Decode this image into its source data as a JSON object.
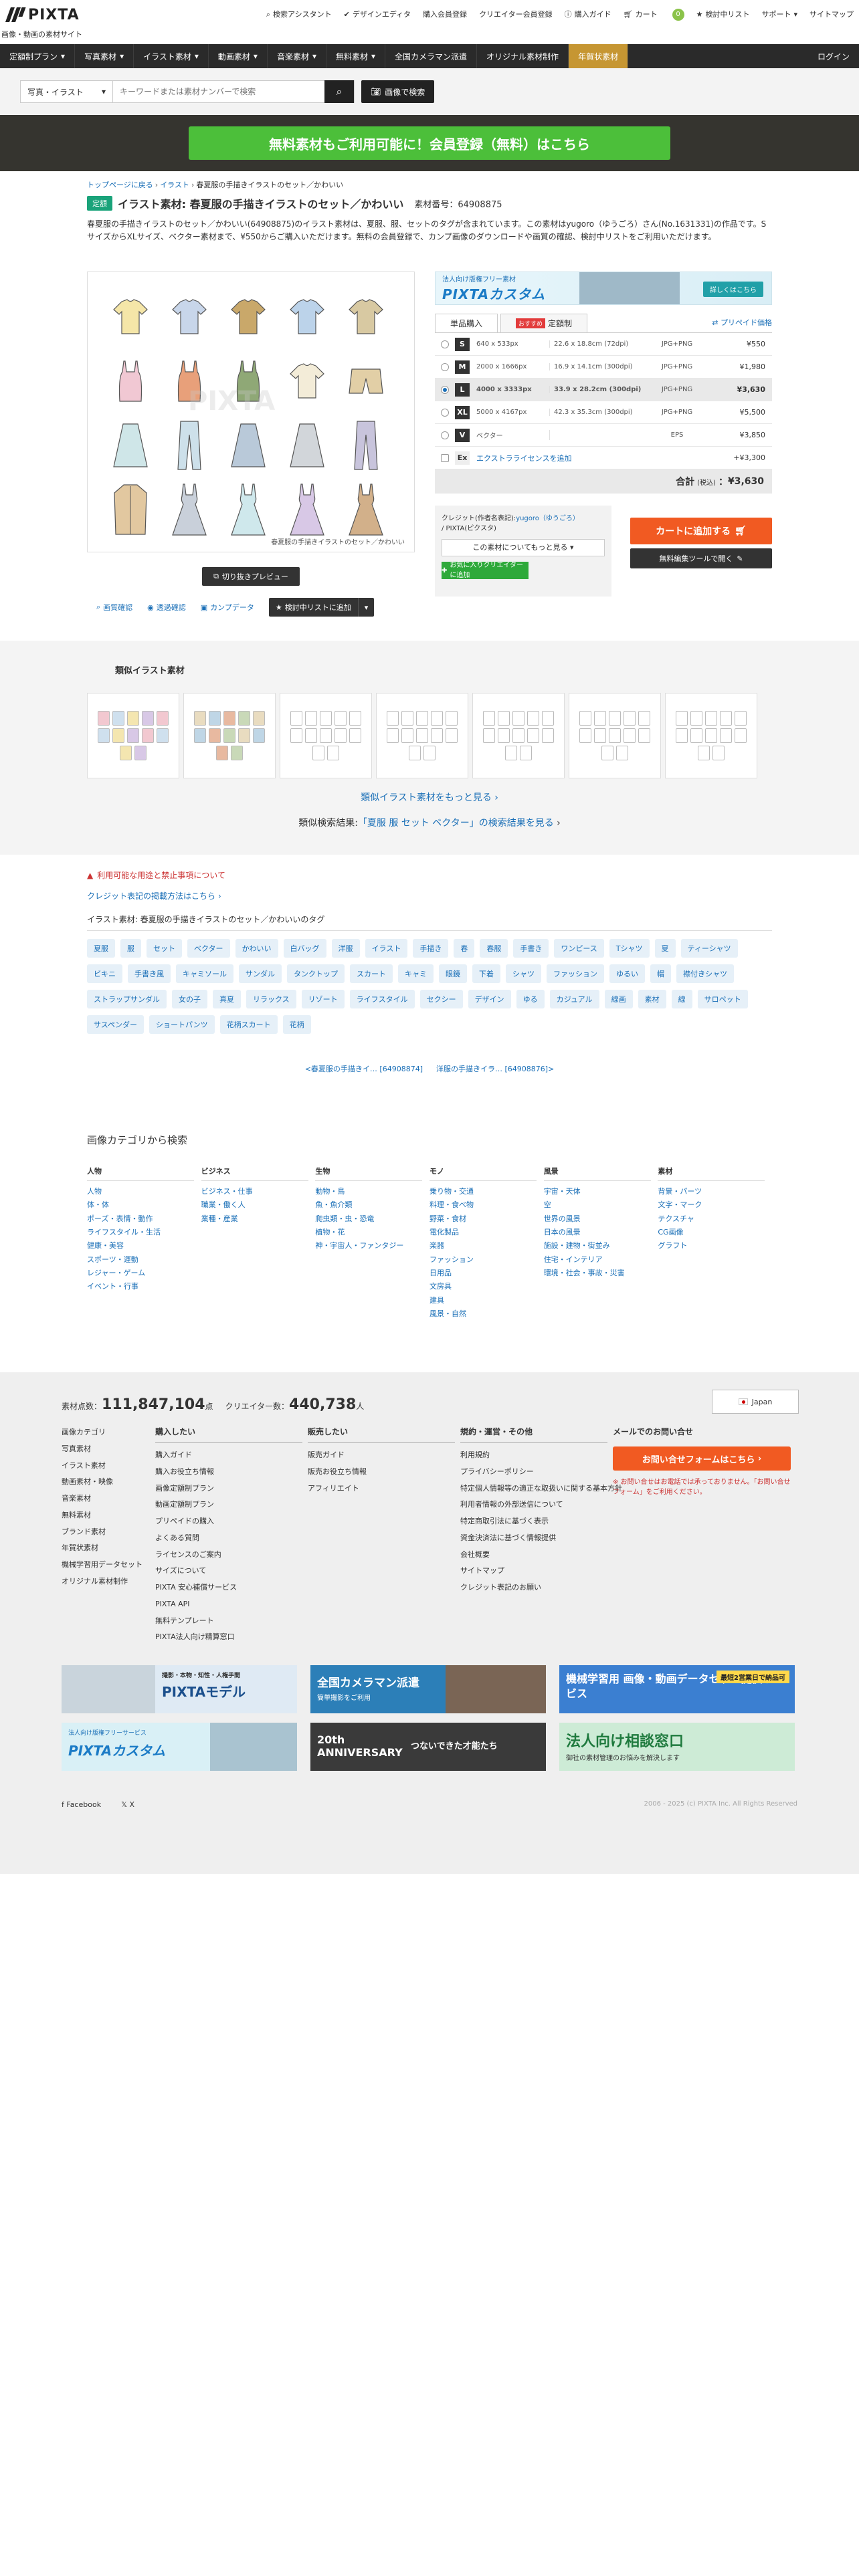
{
  "header": {
    "logo": "PIXTA",
    "subtitle": "画像・動画の素材サイト",
    "nav": [
      {
        "icon": "search-icon",
        "label": "検索アシスタント"
      },
      {
        "icon": "check-icon",
        "label": "デザインエディタ"
      },
      {
        "icon": "",
        "label": "購入会員登録"
      },
      {
        "icon": "",
        "label": "クリエイター会員登録"
      },
      {
        "icon": "info-icon",
        "label": "購入ガイド"
      },
      {
        "icon": "cart-icon",
        "label": "カート",
        "badge": "0"
      },
      {
        "icon": "star-icon",
        "label": "検討中リスト"
      },
      {
        "icon": "",
        "label": "サポート"
      },
      {
        "icon": "",
        "label": "サイトマップ"
      }
    ]
  },
  "gnav": {
    "items": [
      "定額制プラン",
      "写真素材",
      "イラスト素材",
      "動画素材",
      "音楽素材",
      "無料素材",
      "全国カメラマン派遣",
      "オリジナル素材制作"
    ],
    "sale": "年賀状素材",
    "login": "ログイン"
  },
  "search": {
    "category": "写真・イラスト",
    "placeholder": "キーワードまたは素材ナンバーで検索",
    "image_search": "画像で検索"
  },
  "banner": {
    "label": "無料素材もご利用可能に！会員登録（無料）はこちら"
  },
  "breadcrumb": [
    "トップページに戻る",
    "イラスト",
    "春夏服の手描きイラストのセット／かわいい"
  ],
  "item": {
    "badge": "定額",
    "title": "イラスト素材: 春夏服の手描きイラストのセット／かわいい",
    "number_label": "素材番号：64908875",
    "description": "春夏服の手描きイラストのセット／かわいい(64908875)のイラスト素材は、夏服、服、セットのタグが含まれています。この素材はyugoro（ゆうごろ）さん(No.1631331)の作品です。SサイズからXLサイズ、ベクター素材まで、¥550からご購入いただけます。無料の会員登録で、カンプ画像のダウンロードや画質の確認、検討中リストをご利用いただけます。",
    "caption": "春夏服の手描きイラストのセット／かわいい",
    "watermark": "PIXTA",
    "preview": "切り抜きプレビュー",
    "links": [
      {
        "icon": "zoom-icon",
        "label": "画質確認"
      },
      {
        "icon": "eye-icon",
        "label": "透過確認"
      },
      {
        "icon": "image-icon",
        "label": "カンプデータ"
      }
    ],
    "fav": "検討中リストに追加"
  },
  "custom_banner": {
    "sub": "法人向け版権フリー素材",
    "title": "PIXTAカスタム",
    "btn": "詳しくはこちら"
  },
  "tabs": {
    "single": "単品購入",
    "osusume": "おすすめ",
    "subscription": "定額制",
    "prepaid": "プリペイド価格"
  },
  "sizes": [
    {
      "size": "S",
      "px": "640 x 533px",
      "cm": "22.6 x 18.8cm (72dpi)",
      "fmt": "JPG+PNG",
      "price": "¥550",
      "selected": false
    },
    {
      "size": "M",
      "px": "2000 x 1666px",
      "cm": "16.9 x 14.1cm (300dpi)",
      "fmt": "JPG+PNG",
      "price": "¥1,980",
      "selected": false
    },
    {
      "size": "L",
      "px": "4000 x 3333px",
      "cm": "33.9 x 28.2cm (300dpi)",
      "fmt": "JPG+PNG",
      "price": "¥3,630",
      "selected": true
    },
    {
      "size": "XL",
      "px": "5000 x 4167px",
      "cm": "42.3 x 35.3cm (300dpi)",
      "fmt": "JPG+PNG",
      "price": "¥5,500",
      "selected": false
    },
    {
      "size": "V",
      "px": "ベクター",
      "cm": "",
      "fmt": "EPS",
      "price": "¥3,850",
      "selected": false
    }
  ],
  "extra": {
    "size": "Ex",
    "label": "エクストラライセンスを追加",
    "price": "+¥3,300"
  },
  "total": {
    "label": "合計",
    "tax": "(税込)",
    "value": "¥3,630"
  },
  "credit": {
    "label": "クレジット(作者名表記):",
    "author": "yugoro（ゆうごろ）",
    "suffix": "/ PIXTA(ピクスタ)",
    "more": "この素材についてもっと見る",
    "fav": "お気に入りクリエイターに追加"
  },
  "cart": {
    "add": "カートに追加する",
    "edit": "無料編集ツールで開く"
  },
  "similar": {
    "title": "類似イラスト素材",
    "more": "類似イラスト素材をもっと見る",
    "search_prefix": "類似検索結果:",
    "search_link": "「夏服 服 セット ベクター」の検索結果を見る"
  },
  "info": {
    "warn": "利用可能な用途と禁止事項について",
    "credit_link": "クレジット表記の掲載方法はこちら",
    "tag_head": "イラスト素材: 春夏服の手描きイラストのセット／かわいいのタグ",
    "tags": [
      "夏服",
      "服",
      "セット",
      "ベクター",
      "かわいい",
      "白バッグ",
      "洋服",
      "イラスト",
      "手描き",
      "春",
      "春服",
      "手書き",
      "ワンピース",
      "Tシャツ",
      "夏",
      "ティーシャツ",
      "ビキニ",
      "手書き風",
      "キャミソール",
      "サンダル",
      "タンクトップ",
      "スカート",
      "キャミ",
      "眼鏡",
      "下着",
      "シャツ",
      "ファッション",
      "ゆるい",
      "帽",
      "襟付きシャツ",
      "ストラップサンダル",
      "女の子",
      "真夏",
      "リラックス",
      "リゾート",
      "ライフスタイル",
      "セクシー",
      "デザイン",
      "ゆる",
      "カジュアル",
      "線画",
      "素材",
      "線",
      "サロペット",
      "サスペンダー",
      "ショートパンツ",
      "花柄スカート",
      "花柄"
    ],
    "prev": "<春夏服の手描きイ… [64908874]",
    "next": "洋服の手描きイラ… [64908876]>"
  },
  "categories": {
    "title": "画像カテゴリから検索",
    "cols": [
      {
        "h": "人物",
        "items": [
          "人物",
          "体・体",
          "ポーズ・表情・動作",
          "ライフスタイル・生活",
          "健康・美容",
          "スポーツ・運動",
          "レジャー・ゲーム",
          "イベント・行事"
        ]
      },
      {
        "h": "ビジネス",
        "items": [
          "ビジネス・仕事",
          "職業・働く人",
          "業種・産業"
        ]
      },
      {
        "h": "生物",
        "items": [
          "動物・鳥",
          "魚・魚介類",
          "爬虫類・虫・恐竜",
          "植物・花",
          "神・宇宙人・ファンタジー"
        ]
      },
      {
        "h": "モノ",
        "items": [
          "乗り物・交通",
          "料理・食べ物",
          "野菜・食材",
          "電化製品",
          "楽器",
          "ファッション",
          "日用品",
          "文房具",
          "建具",
          "風景・自然"
        ]
      },
      {
        "h": "風景",
        "items": [
          "宇宙・天体",
          "空",
          "世界の風景",
          "日本の風景",
          "施設・建物・街並み",
          "住宅・インテリア",
          "環境・社会・事故・災害"
        ]
      },
      {
        "h": "素材",
        "items": [
          "背景・パーツ",
          "文字・マーク",
          "テクスチャ",
          "CG画像",
          "グラフト"
        ]
      }
    ]
  },
  "footer": {
    "stats_label": "素材点数：",
    "stats_value": "111,847,104",
    "stats_unit": "点",
    "creators_label": "クリエイター数：",
    "creators_value": "440,738",
    "creators_unit": "人",
    "lang": "Japan",
    "col1": [
      "画像カテゴリ",
      "写真素材",
      "イラスト素材",
      "動画素材・映像",
      "音楽素材",
      "無料素材",
      "ブランド素材",
      "年賀状素材",
      "機械学習用データセット",
      "オリジナル素材制作"
    ],
    "buy": {
      "h": "購入したい",
      "items": [
        "購入ガイド",
        "購入お役立ち情報",
        "画像定額制プラン",
        "動画定額制プラン",
        "プリペイドの購入",
        "よくある質問",
        "ライセンスのご案内",
        "サイズについて",
        "PIXTA 安心補償サービス",
        "PIXTA API",
        "無料テンプレート",
        "PIXTA法人向け精算窓口"
      ]
    },
    "sell": {
      "h": "販売したい",
      "items": [
        "販売ガイド",
        "販売お役立ち情報",
        "アフィリエイト"
      ]
    },
    "terms": {
      "h": "規約・運営・その他",
      "items": [
        "利用規約",
        "プライバシーポリシー",
        "特定個人情報等の適正な取扱いに関する基本方針",
        "利用者情報の外部送信について",
        "特定商取引法に基づく表示",
        "資金決済法に基づく情報提供",
        "会社概要",
        "サイトマップ",
        "クレジット表記のお願い"
      ]
    },
    "contact": {
      "h": "メールでのお問い合せ",
      "btn": "お問い合せフォームはこちら",
      "note": "※ お問い合せはお電話では承っておりません。「お問い合せフォーム」をご利用ください。"
    },
    "banners": [
      {
        "title": "PIXTAモデル",
        "sub": "撮影・本物・知性・人権手間"
      },
      {
        "title": "全国カメラマン派遣",
        "sub": "簡単撮影をご利用"
      },
      {
        "title": "機械学習用 画像・動画データセット提供サービス",
        "sub": "最短2営業日で納品可"
      },
      {
        "title": "PIXTAカスタム",
        "sub": "法人向け版権フリーサービス"
      },
      {
        "title": "20th ANNIVERSARY",
        "sub": "つないできた才能たち"
      },
      {
        "title": "法人向け相談窓口",
        "sub": "御社の素材管理のお悩みを解決します"
      }
    ],
    "social": [
      "Facebook",
      "X"
    ],
    "copyright": "2006 - 2025 (c) PIXTA Inc. All Rights Reserved"
  }
}
